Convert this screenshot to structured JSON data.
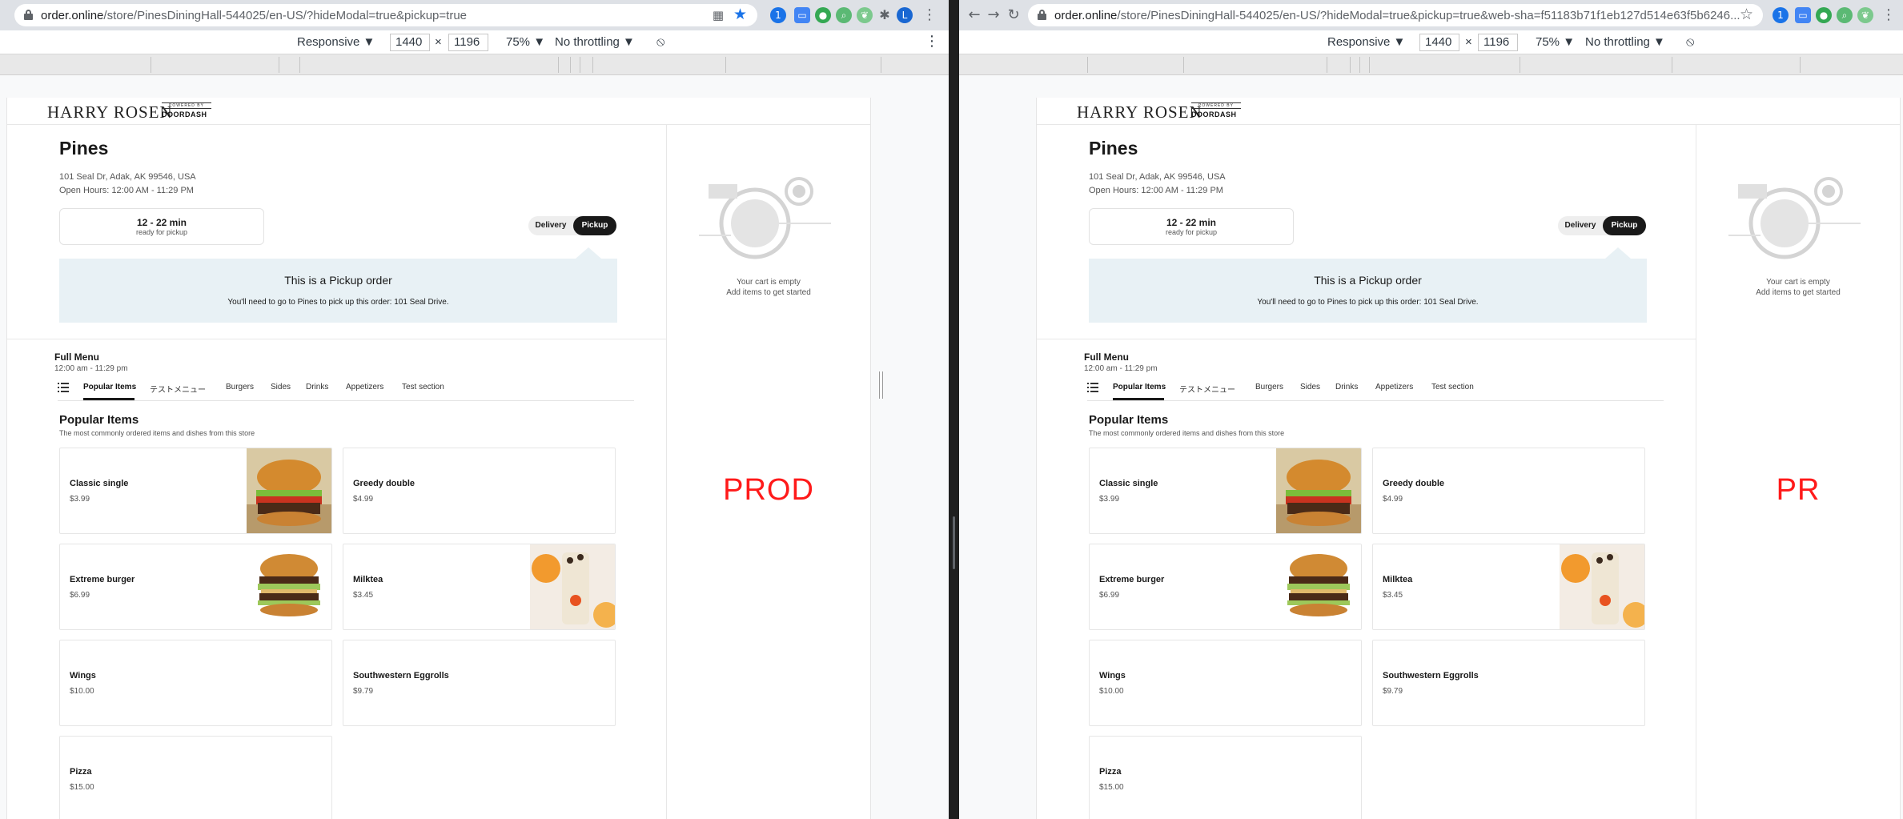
{
  "browser_left": {
    "url_main": "order.online",
    "url_rest": "/store/PinesDiningHall-544025/en-US/?hideModal=true&pickup=true",
    "avatar_letter": "L",
    "ext_badge": "1"
  },
  "browser_right": {
    "url_main": "order.online",
    "url_rest": "/store/PinesDiningHall-544025/en-US/?hideModal=true&pickup=true&web-sha=f51183b71f1eb127d514e63f5b6246...",
    "ext_badge": "1"
  },
  "devtools": {
    "device": "Responsive ▼",
    "width": "1440",
    "times": "×",
    "height": "1196",
    "zoom": "75% ▼",
    "throttle": "No throttling ▼",
    "more": "⋮"
  },
  "site": {
    "brand": "HARRY ROSEN",
    "powered_by": "POWERED BY",
    "doordash": "DOORDASH"
  },
  "store": {
    "name": "Pines",
    "address": "101 Seal Dr, Adak, AK 99546, USA",
    "open_hours": "Open Hours: 12:00 AM - 11:29 PM",
    "eta": "12 - 22 min",
    "eta_sub": "ready for pickup",
    "toggle_delivery": "Delivery",
    "toggle_pickup": "Pickup",
    "notice_title": "This is a Pickup order",
    "notice_body": "You'll need to go to Pines to pick up this order: 101 Seal Drive."
  },
  "menu": {
    "title": "Full Menu",
    "hours": "12:00 am - 11:29 pm",
    "tabs": [
      "Popular Items",
      "テストメニュー",
      "Burgers",
      "Sides",
      "Drinks",
      "Appetizers",
      "Test section"
    ],
    "section_title": "Popular Items",
    "section_sub": "The most commonly ordered items and dishes from this store",
    "items": [
      {
        "name": "Classic single",
        "price": "$3.99"
      },
      {
        "name": "Greedy double",
        "price": "$4.99"
      },
      {
        "name": "Extreme burger",
        "price": "$6.99"
      },
      {
        "name": "Milktea",
        "price": "$3.45"
      },
      {
        "name": "Wings",
        "price": "$10.00"
      },
      {
        "name": "Southwestern Eggrolls",
        "price": "$9.79"
      },
      {
        "name": "Pizza",
        "price": "$15.00"
      }
    ]
  },
  "cart": {
    "empty_line1": "Your cart is empty",
    "empty_line2": "Add items to get started"
  },
  "labels": {
    "left": "PROD",
    "right": "PR"
  },
  "colors": {
    "label_red": "#ff1a1a",
    "pickup_notice_bg": "#e8f1f5",
    "chrome_blue": "#1a73e8"
  }
}
